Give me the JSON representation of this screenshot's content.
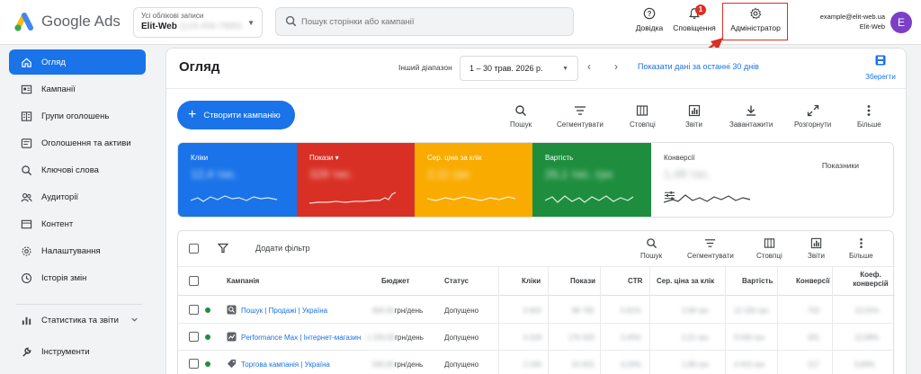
{
  "app": {
    "name": "Google Ads"
  },
  "account": {
    "label": "Усі облікові записи",
    "name": "Elit-Web",
    "id": "(123-456-7890)"
  },
  "search": {
    "placeholder": "Пошук сторінки або кампанії"
  },
  "topbar": {
    "help_label": "Довідка",
    "notifications_label": "Сповіщення",
    "notifications_count": "1",
    "admin_label": "Адміністратор",
    "user_email": "example@elit-web.ua",
    "user_account": "Elit-Web",
    "avatar_letter": "E"
  },
  "sidebar": {
    "items": [
      {
        "label": "Огляд",
        "icon": "home-icon"
      },
      {
        "label": "Кампанії",
        "icon": "campaigns-icon"
      },
      {
        "label": "Групи оголошень",
        "icon": "ad-groups-icon"
      },
      {
        "label": "Оголошення та активи",
        "icon": "ads-icon"
      },
      {
        "label": "Ключові слова",
        "icon": "search-icon"
      },
      {
        "label": "Аудиторії",
        "icon": "audiences-icon"
      },
      {
        "label": "Контент",
        "icon": "content-icon"
      },
      {
        "label": "Налаштування",
        "icon": "gear-icon"
      },
      {
        "label": "Історія змін",
        "icon": "history-icon"
      }
    ],
    "reports_label": "Статистика та звіти",
    "tools_label": "Інструменти"
  },
  "header": {
    "title": "Огляд",
    "range_label": "Інший діапазон",
    "date_range": "1 – 30 трав. 2026 р.",
    "show_last_link": "Показати дані за останні 30 днів",
    "save_label": "Зберегти"
  },
  "toolbar": {
    "create_label": "Створити кампанію",
    "tools": [
      "Пошук",
      "Сегментувати",
      "Стовпці",
      "Звіти",
      "Завантажити",
      "Розгорнути",
      "Більше"
    ]
  },
  "metrics": {
    "cards": [
      {
        "label": "Кліки",
        "value": "12,4 тис.",
        "color": "#1a73e8"
      },
      {
        "label": "Покази ▾",
        "value": "328 тис.",
        "color": "#d93025"
      },
      {
        "label": "Сер. ціна за клік",
        "value": "2,11 грн",
        "color": "#f9ab00"
      },
      {
        "label": "Вартість",
        "value": "26,1 тис. грн",
        "color": "#1e8e3e"
      },
      {
        "label": "Конверсії",
        "value": "1,48 тис.",
        "color": "#ffffff"
      }
    ],
    "indicators_label": "Показники"
  },
  "table": {
    "add_filter": "Додати фільтр",
    "tools": [
      "Пошук",
      "Сегментувати",
      "Стовпці",
      "Звіти",
      "Більше"
    ],
    "columns": [
      "Кампанія",
      "Бюджет",
      "Статус",
      "Кліки",
      "Покази",
      "CTR",
      "Сер. ціна за клік",
      "Вартість",
      "Конверсії",
      "Коеф. конверсій"
    ],
    "rows": [
      {
        "campaign": "Пошук | Продажі | Україна",
        "budget": "600,00",
        "budget_unit": "грн/день",
        "status": "Допущено",
        "clicks": "5 842",
        "impr": "98 765",
        "ctr": "5,91%",
        "cpc": "2,08 грн",
        "cost": "12 150 грн",
        "conv": "702",
        "rate": "12,01%"
      },
      {
        "campaign": "Performance Max | Інтернет-магазин",
        "budget": "1 200,00",
        "budget_unit": "грн/день",
        "status": "Допущено",
        "clicks": "4 318",
        "impr": "176 420",
        "ctr": "2,45%",
        "cpc": "2,21 грн",
        "cost": "9 540 грн",
        "conv": "561",
        "rate": "12,99%"
      },
      {
        "campaign": "Торгова кампанія | Україна",
        "budget": "500,00",
        "budget_unit": "грн/день",
        "status": "Допущено",
        "clicks": "2 240",
        "impr": "52 815",
        "ctr": "4,24%",
        "cpc": "1,98 грн",
        "cost": "4 410 грн",
        "conv": "217",
        "rate": "9,69%"
      }
    ]
  }
}
